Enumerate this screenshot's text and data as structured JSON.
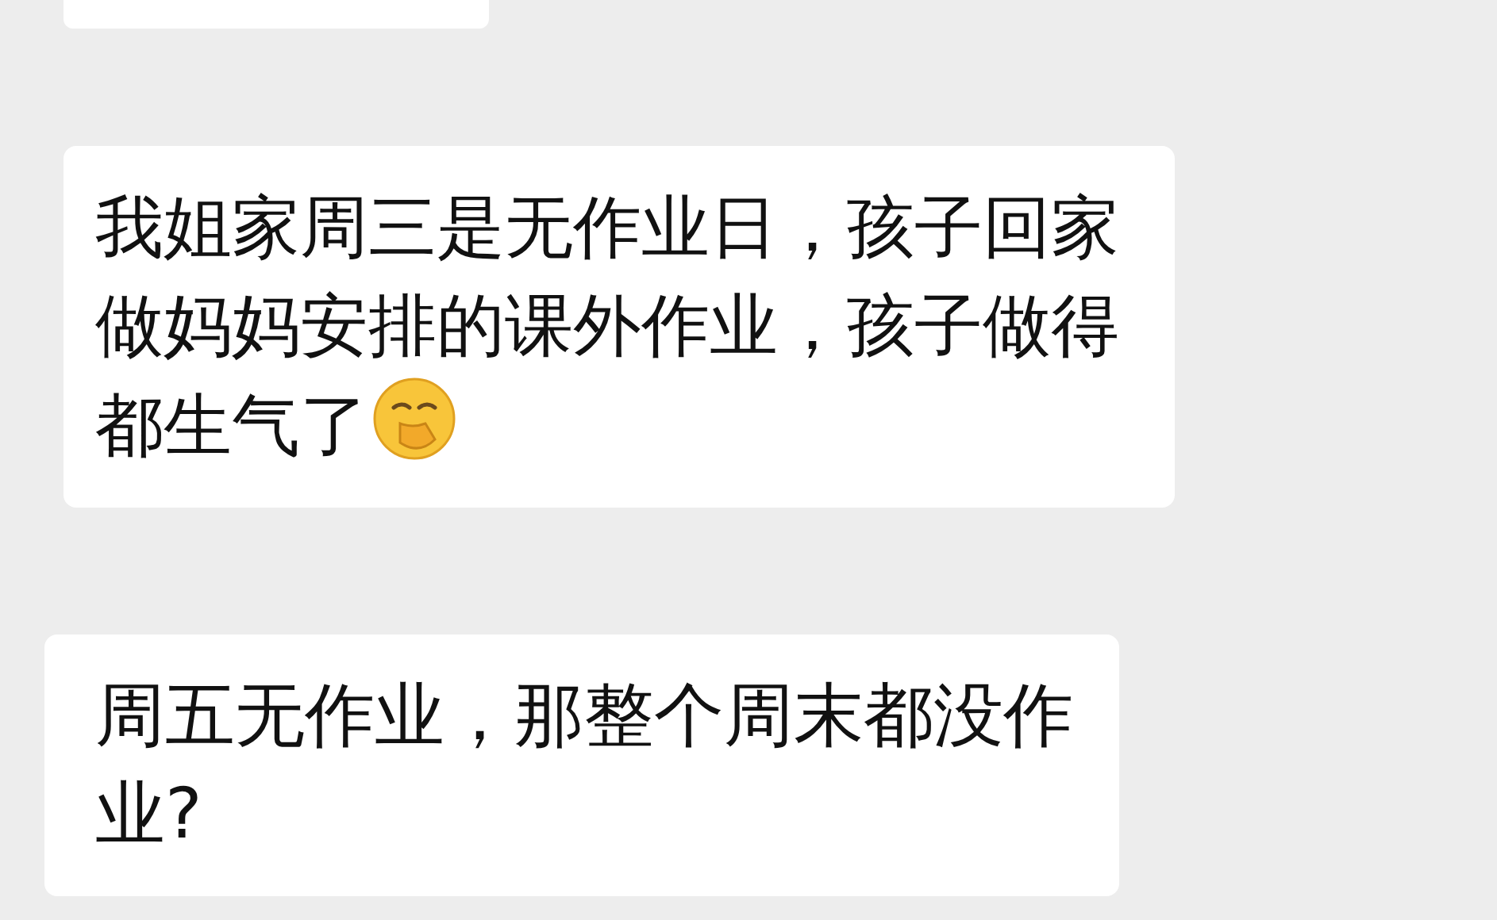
{
  "messages": [
    {
      "kind": "cut"
    },
    {
      "kind": "text",
      "text": "我姐家周三是无作业日，孩子回家做妈妈安排的课外作业，孩子做得都生气了",
      "emoji": true
    },
    {
      "kind": "text",
      "text": "周五无作业，那整个周末都没作业?"
    }
  ]
}
